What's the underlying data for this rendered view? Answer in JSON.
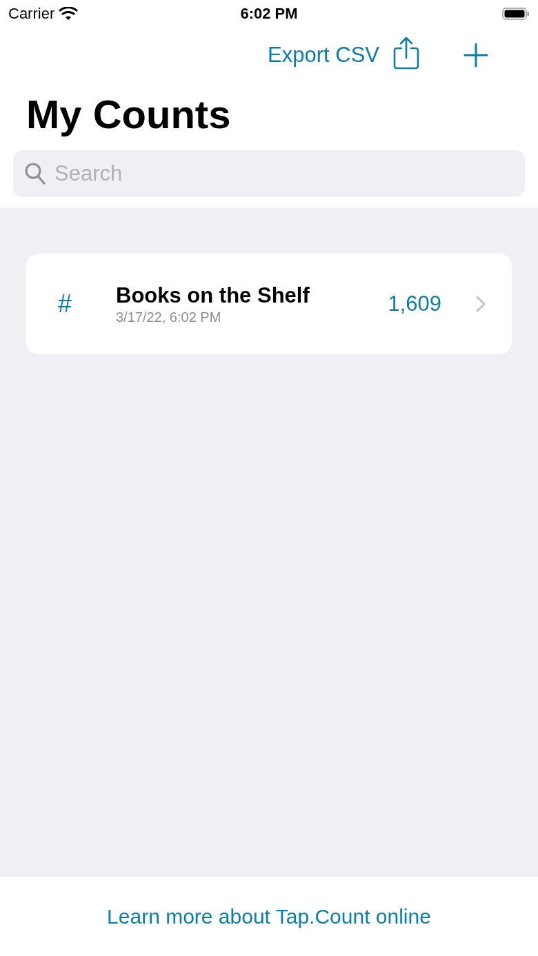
{
  "status_bar": {
    "carrier": "Carrier",
    "time": "6:02 PM"
  },
  "nav": {
    "export_label": "Export CSV"
  },
  "title": "My Counts",
  "search": {
    "placeholder": "Search"
  },
  "counts": [
    {
      "symbol": "#",
      "name": "Books on the Shelf",
      "date": "3/17/22, 6:02 PM",
      "value": "1,609"
    }
  ],
  "footer": {
    "link": "Learn more about Tap.Count online"
  }
}
